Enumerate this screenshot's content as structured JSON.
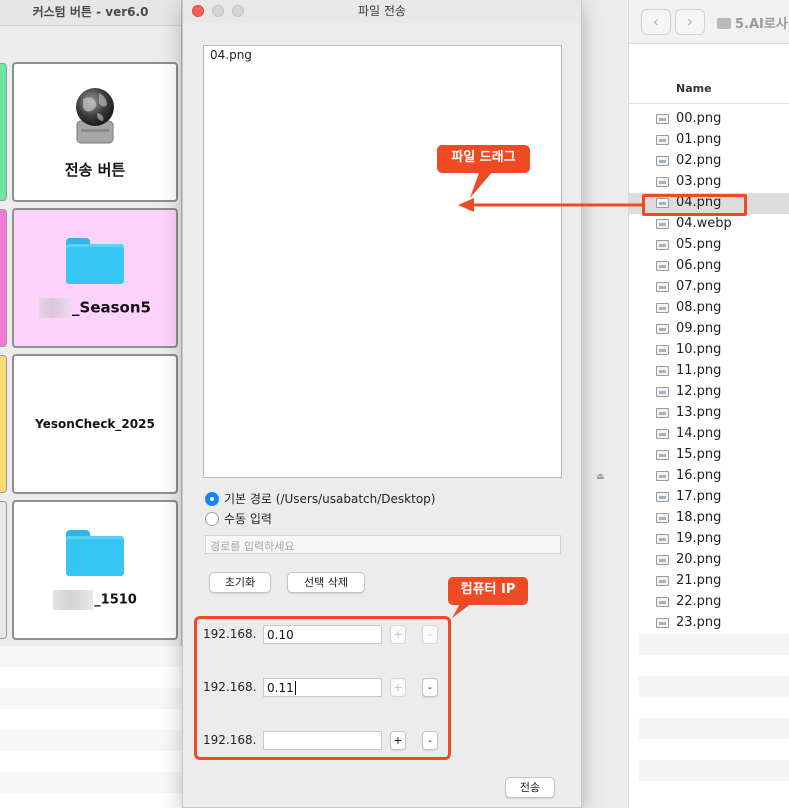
{
  "left_app": {
    "title": "커스텀 버튼 - ver6.0",
    "tiles": [
      {
        "label": "전송 버튼",
        "icon": "globe-drive-icon"
      },
      {
        "label": "_Season5",
        "icon": "folder-icon"
      },
      {
        "label": "YesonCheck_2025",
        "icon": ""
      },
      {
        "label": "_1510",
        "icon": "folder-icon"
      }
    ],
    "strip_colors": [
      "#6de6a0",
      "#f47ad7",
      "#f8dc6f",
      "#d7d7d7"
    ]
  },
  "dialog": {
    "title": "파일 전송",
    "drop_items": [
      "04.png"
    ],
    "radio_default_label": "기본 경로 (/Users/usabatch/Desktop)",
    "radio_manual_label": "수동 입력",
    "path_placeholder": "경로를 입력하세요",
    "reset_button": "초기화",
    "delete_selected_button": "선택 삭제",
    "ip_rows": [
      {
        "prefix": "192.168.",
        "value": "0.10",
        "plus": "+",
        "minus": "-"
      },
      {
        "prefix": "192.168.",
        "value": "0.11",
        "plus": "+",
        "minus": "-"
      },
      {
        "prefix": "192.168.",
        "value": "",
        "plus": "+",
        "minus": "-"
      }
    ],
    "send_button": "전송"
  },
  "finder": {
    "path": "5.AI로사",
    "column_header": "Name",
    "back_icon": "‹",
    "forward_icon": "›",
    "files": [
      "00.png",
      "01.png",
      "02.png",
      "03.png",
      "04.png",
      "04.webp",
      "05.png",
      "06.png",
      "07.png",
      "08.png",
      "09.png",
      "10.png",
      "11.png",
      "12.png",
      "13.png",
      "14.png",
      "15.png",
      "16.png",
      "17.png",
      "18.png",
      "19.png",
      "20.png",
      "21.png",
      "22.png",
      "23.png"
    ],
    "selected_file": "04.png"
  },
  "annotations": {
    "drag_label": "파일 드래그",
    "ip_label": "컴퓨터 IP",
    "color": "#ee4b25"
  }
}
